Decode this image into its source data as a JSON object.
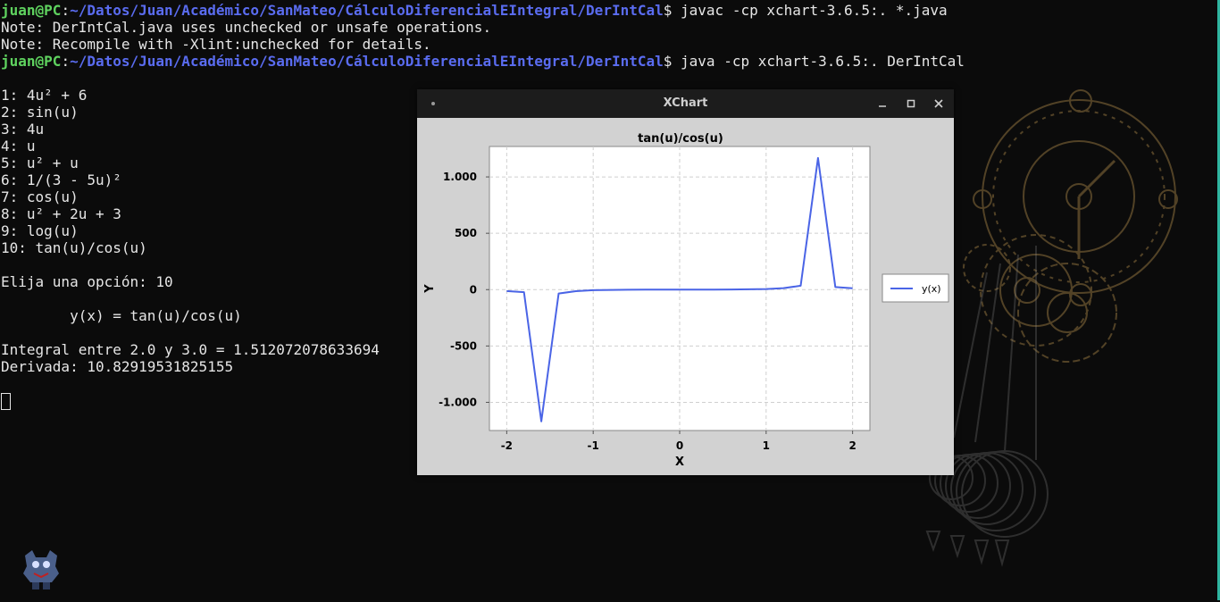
{
  "terminal": {
    "prompt_user": "juan@PC",
    "prompt_sep": ":",
    "prompt_path": "~/Datos/Juan/Académico/SanMateo/CálculoDiferencialEIntegral/DerIntCal",
    "prompt_end": "$",
    "cmd1": " javac -cp xchart-3.6.5:. *.java",
    "note1": "Note: DerIntCal.java uses unchecked or unsafe operations.",
    "note2": "Note: Recompile with -Xlint:unchecked for details.",
    "cmd2": " java -cp xchart-3.6.5:. DerIntCal",
    "menu": [
      "1: 4u² + 6",
      "2: sin(u)",
      "3: 4u",
      "4: u",
      "5: u² + u",
      "6: 1/(3 - 5u)²",
      "7: cos(u)",
      "8: u² + 2u + 3",
      "9: log(u)",
      "10: tan(u)/cos(u)"
    ],
    "choice": "Elija una opción: 10",
    "function_line": "        y(x) = tan(u)/cos(u)",
    "integral_line": "Integral entre 2.0 y 3.0 = 1.512072078633694",
    "derivative_line": "Derivada: 10.82919531825155"
  },
  "window": {
    "title": "XChart"
  },
  "colors": {
    "series": "#4a64e6",
    "plot_bg": "#ffffff",
    "chart_bg": "#d2d2d2",
    "title_bar": "#1c1c1c"
  },
  "chart_data": {
    "type": "line",
    "title": "tan(u)/cos(u)",
    "xlabel": "X",
    "ylabel": "Y",
    "xlim": [
      -2.2,
      2.2
    ],
    "ylim": [
      -1250,
      1270
    ],
    "x_ticks": [
      -2,
      -1,
      0,
      1,
      2
    ],
    "x_tick_labels": [
      "-2",
      "-1",
      "0",
      "1",
      "2"
    ],
    "y_ticks": [
      1000,
      500,
      0,
      -500,
      -1000
    ],
    "y_tick_labels": [
      "1.000",
      "500",
      "0",
      "-500",
      "-1.000"
    ],
    "grid": true,
    "legend_position": "right",
    "series": [
      {
        "name": "y(x)",
        "x": [
          -2.0,
          -1.8,
          -1.6,
          -1.4,
          -1.2,
          -1.0,
          -0.8,
          -0.6,
          -0.4,
          -0.2,
          0.0,
          0.2,
          0.4,
          0.6,
          0.8,
          1.0,
          1.2,
          1.4,
          1.6,
          1.8,
          2.0
        ],
        "values": [
          -12.6,
          -22.3,
          -1168,
          -34.2,
          -13.4,
          -5.3,
          -2.9,
          -1.0,
          -0.5,
          -0.2,
          0.0,
          0.2,
          0.5,
          1.0,
          2.9,
          5.3,
          13.4,
          34.2,
          1168,
          22.3,
          12.6
        ]
      }
    ]
  }
}
